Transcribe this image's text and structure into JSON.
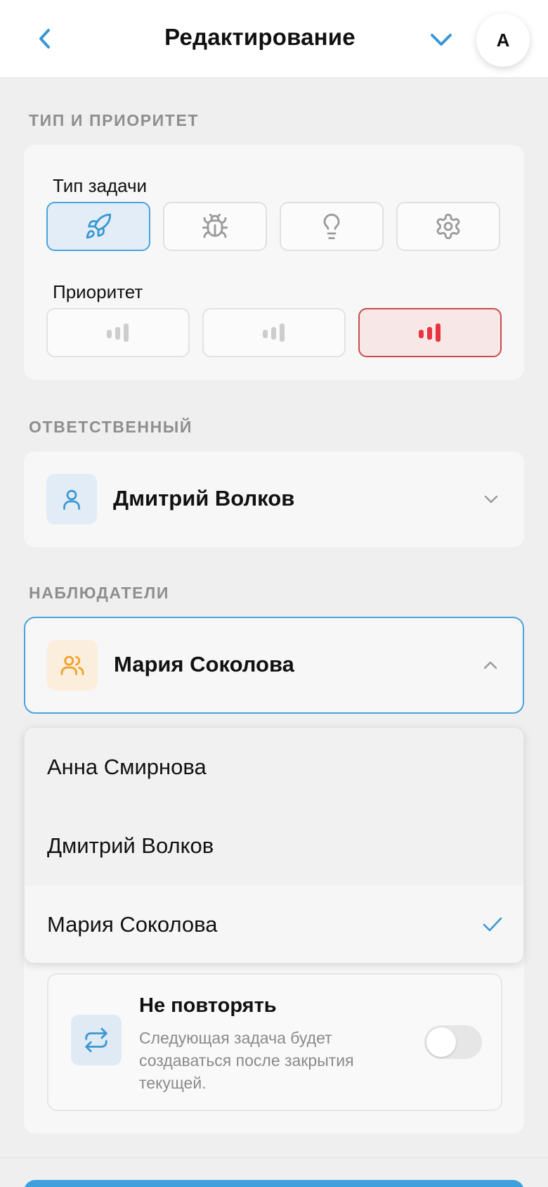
{
  "header": {
    "title": "Редактирование",
    "back_icon": "chevron-left-icon",
    "collapse_icon": "chevron-down-icon",
    "avatar_initial": "A"
  },
  "type_priority": {
    "section_label": "ТИП И ПРИОРИТЕТ",
    "type_label": "Тип задачи",
    "types": [
      {
        "icon": "rocket-icon",
        "selected": true
      },
      {
        "icon": "bug-icon",
        "selected": false
      },
      {
        "icon": "lightbulb-icon",
        "selected": false
      },
      {
        "icon": "gear-icon",
        "selected": false
      }
    ],
    "priority_label": "Приоритет",
    "priorities": [
      {
        "icon": "signal-low-icon",
        "level": 1,
        "selected": false
      },
      {
        "icon": "signal-medium-icon",
        "level": 2,
        "selected": false
      },
      {
        "icon": "signal-high-icon",
        "level": 3,
        "selected": true
      }
    ]
  },
  "assignee": {
    "section_label": "ОТВЕТСТВЕННЫЙ",
    "value": "Дмитрий Волков",
    "icon": "user-icon"
  },
  "watchers": {
    "section_label": "НАБЛЮДАТЕЛИ",
    "value": "Мария Соколова",
    "icon": "users-icon",
    "options": [
      {
        "label": "Анна Смирнова",
        "selected": false
      },
      {
        "label": "Дмитрий Волков",
        "selected": false
      },
      {
        "label": "Мария Соколова",
        "selected": true
      }
    ]
  },
  "repeat": {
    "title": "Не повторять",
    "description": "Следующая задача будет создаваться после закрытия текущей.",
    "icon": "repeat-icon",
    "enabled": false
  },
  "colors": {
    "accent": "#3ea0dd",
    "priority_high": "#e8343f",
    "watcher_icon": "#f0a32a"
  }
}
